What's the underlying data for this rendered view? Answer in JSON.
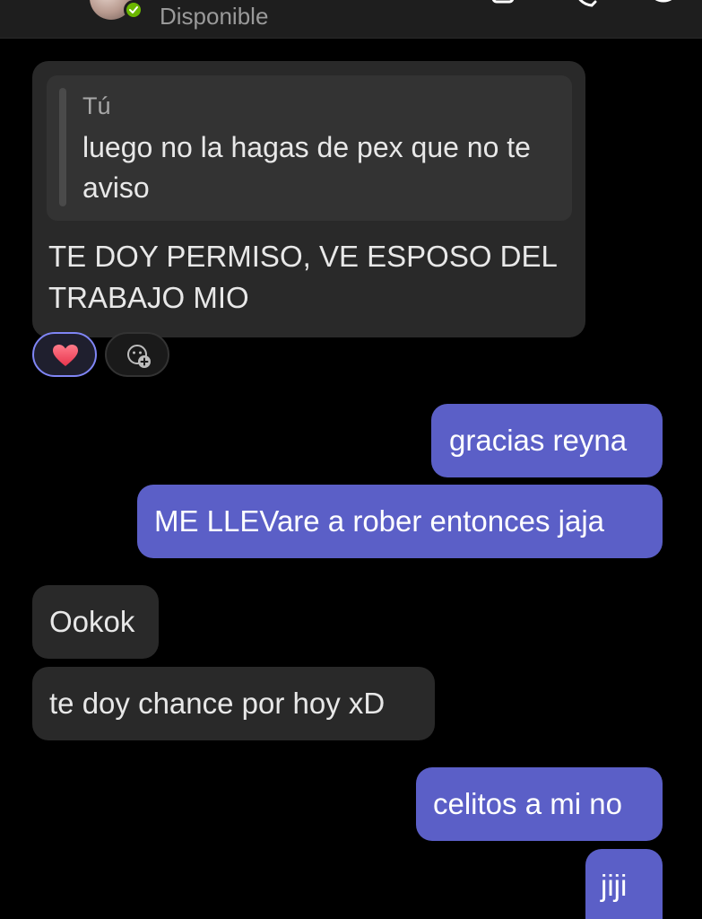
{
  "header": {
    "status": "Disponible"
  },
  "messages": {
    "quoted_reply": {
      "quote_author": "Tú",
      "quote_text": "luego no la hagas de pex que no te aviso",
      "text": "TE DOY PERMISO, VE ESPOSO DEL TRABAJO MIO"
    },
    "m1": "gracias reyna",
    "m2": "ME LLEVare a rober entonces jaja",
    "m3": "Ookok",
    "m4": "te doy chance por hoy xD",
    "m5": "celitos a mi no",
    "m6": "jiji"
  },
  "colors": {
    "sent_bubble": "#5b5fc7",
    "received_bubble": "#292929",
    "background": "#000000",
    "presence_available": "#6bb700",
    "reaction_selected_border": "#7f85f5"
  },
  "icons": {
    "back": "back-arrow-icon",
    "presence": "available-check-icon",
    "heart": "heart-icon",
    "add_reaction": "add-reaction-icon",
    "video": "video-call-icon",
    "call": "phone-call-icon",
    "more": "more-icon"
  }
}
